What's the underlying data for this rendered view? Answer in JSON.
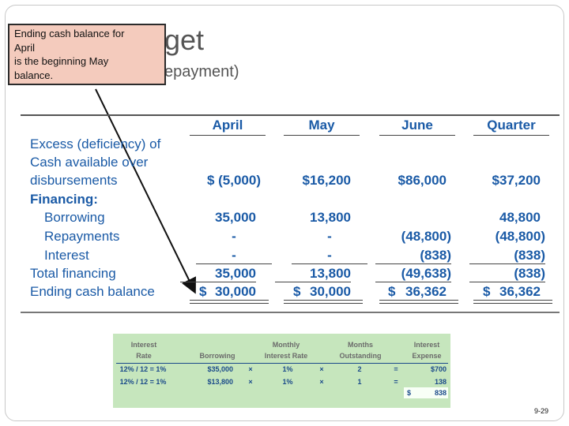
{
  "title": {
    "main": "get",
    "sub": "epayment)"
  },
  "callout": {
    "lines": [
      "Ending cash balance for",
      "April",
      "is the beginning May",
      "balance."
    ]
  },
  "budget": {
    "columns": [
      "April",
      "May",
      "June",
      "Quarter"
    ],
    "labels": {
      "excess1": "Excess (deficiency) of",
      "excess2": "Cash available over",
      "excess3": "disbursements",
      "financing": "Financing:",
      "borrowing": "Borrowing",
      "repayments": "Repayments",
      "interest": "Interest",
      "total": "Total financing",
      "ending": "Ending cash balance"
    },
    "excess": [
      "$ (5,000)",
      "$16,200",
      "$86,000",
      "$37,200"
    ],
    "borrowing": [
      "35,000",
      "13,800",
      "",
      "48,800"
    ],
    "repayments": [
      "-",
      "-",
      "(48,800)",
      "(48,800)"
    ],
    "interest": [
      "-",
      "-",
      "(838)",
      "(838)"
    ],
    "total": [
      "35,000",
      "13,800",
      "(49,638)",
      "(838)"
    ],
    "ending_dollar": "$",
    "ending": [
      "30,000",
      "30,000",
      "36,362",
      "36,362"
    ]
  },
  "interest_table": {
    "headers": {
      "rate1": "Interest",
      "rate2": "Rate",
      "borrowing": "Borrowing",
      "monthly1": "Monthly",
      "monthly2": "Interest Rate",
      "months1": "Months",
      "months2": "Outstanding",
      "expense1": "Interest",
      "expense2": "Expense"
    },
    "rows": [
      {
        "rate": "12% / 12 = 1%",
        "borrowing": "$35,000",
        "times1": "×",
        "monthly": "1%",
        "times2": "×",
        "months": "2",
        "eq": "=",
        "expense": "$700"
      },
      {
        "rate": "12% / 12 = 1%",
        "borrowing": "$13,800",
        "times1": "×",
        "monthly": "1%",
        "times2": "×",
        "months": "1",
        "eq": "=",
        "expense": "138"
      }
    ],
    "total_dollar": "$",
    "total": "838"
  },
  "page_number": "9-29",
  "colors": {
    "text_blue": "#1a5aa6",
    "callout_bg": "#f4cbbd",
    "panel_bg": "#c6e6bd",
    "arrow": "#111111"
  }
}
